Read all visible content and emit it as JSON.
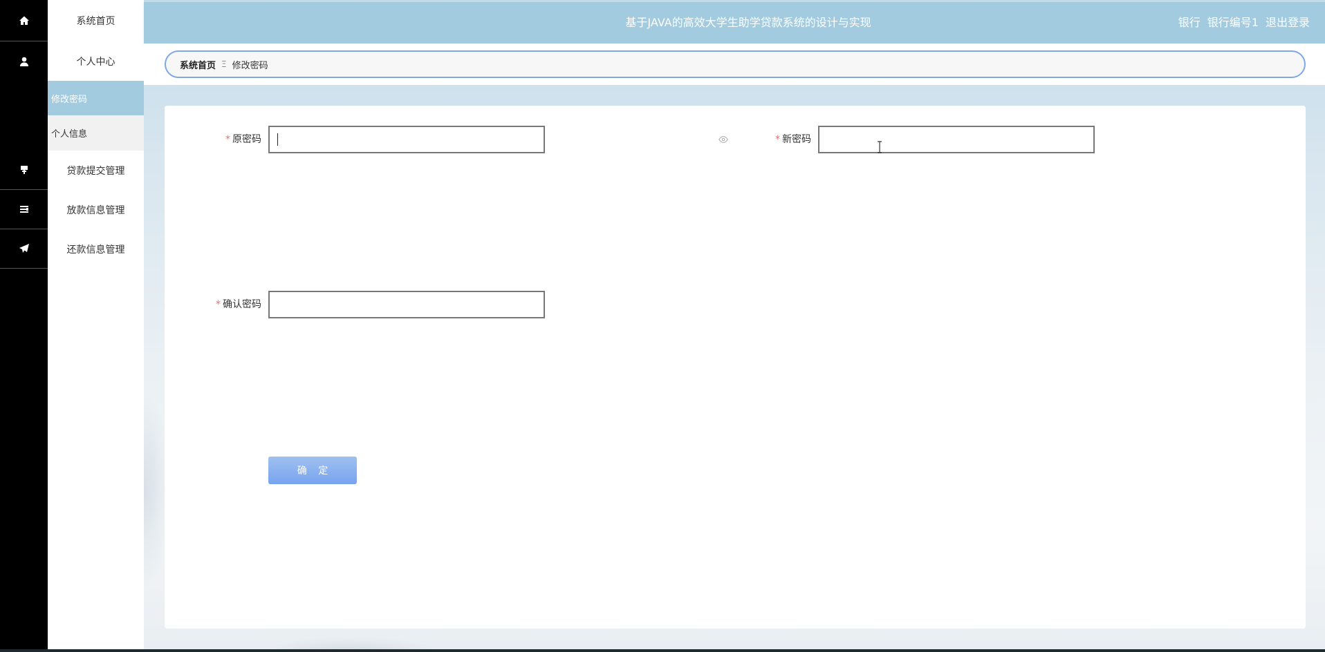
{
  "header": {
    "title": "基于JAVA的高效大学生助学贷款系统的设计与实现",
    "role": "银行",
    "user": "银行编号1",
    "logout": "退出登录"
  },
  "sidebar": {
    "items": [
      {
        "icon": "home-icon",
        "label": "系统首页"
      },
      {
        "icon": "user-icon",
        "label": "个人中心",
        "children": [
          {
            "label": "修改密码",
            "active": true
          },
          {
            "label": "个人信息",
            "active": false
          }
        ]
      },
      {
        "icon": "signpost-icon",
        "label": "贷款提交管理"
      },
      {
        "icon": "list-icon",
        "label": "放款信息管理"
      },
      {
        "icon": "paper-plane-icon",
        "label": "还款信息管理"
      }
    ]
  },
  "breadcrumb": {
    "home": "系统首页",
    "separator": "Ξ",
    "current": "修改密码"
  },
  "form": {
    "old_password": {
      "label": "原密码",
      "value": "",
      "required": true
    },
    "new_password": {
      "label": "新密码",
      "value": "",
      "required": true
    },
    "confirm_password": {
      "label": "确认密码",
      "value": "",
      "required": true
    },
    "submit_label": "确 定"
  },
  "colors": {
    "accent": "#a2cbe0",
    "rail": "#000000",
    "button": "#86acef",
    "required": "#f56c6c"
  }
}
